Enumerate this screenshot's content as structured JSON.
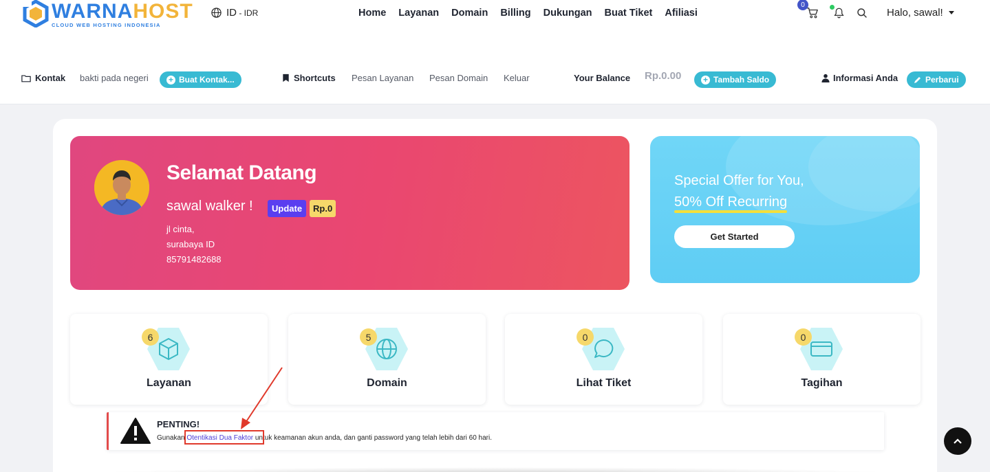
{
  "brand": {
    "word_part1": "WARNA",
    "word_part2": "HOST",
    "tagline": "CLOUD WEB HOSTING INDONESIA"
  },
  "lang": {
    "code": "ID",
    "sep": " - ",
    "currency": "IDR"
  },
  "nav": [
    {
      "label": "Home"
    },
    {
      "label": "Layanan"
    },
    {
      "label": "Domain"
    },
    {
      "label": "Billing"
    },
    {
      "label": "Dukungan"
    },
    {
      "label": "Buat Tiket"
    },
    {
      "label": "Afiliasi"
    }
  ],
  "header": {
    "cart_count": "0",
    "greeting": "Halo, sawal!"
  },
  "subbar": {
    "contact_label": "Kontak",
    "contact_value": "bakti pada negeri",
    "contact_button": "Buat Kontak...",
    "shortcuts_label": "Shortcuts",
    "shortcuts": [
      "Pesan Layanan",
      "Pesan Domain",
      "Keluar"
    ],
    "balance_label": "Your Balance",
    "balance_value": "Rp.0.00",
    "balance_button": "Tambah Saldo",
    "info_label": "Informasi Anda",
    "info_button": "Perbarui"
  },
  "welcome": {
    "title": "Selamat Datang",
    "name": "sawal walker !",
    "badge_update": "Update",
    "badge_credit": "Rp.0",
    "address1": "jl cinta,",
    "address2": "surabaya ID",
    "phone": "85791482688"
  },
  "offer": {
    "line1": "Special Offer for You,",
    "line2": "50% Off Recurring",
    "button": "Get Started"
  },
  "stats": [
    {
      "label": "Layanan",
      "count": "6",
      "icon": "box-icon"
    },
    {
      "label": "Domain",
      "count": "5",
      "icon": "globe-icon"
    },
    {
      "label": "Lihat Tiket",
      "count": "0",
      "icon": "chat-icon"
    },
    {
      "label": "Tagihan",
      "count": "0",
      "icon": "credit-card-icon"
    }
  ],
  "alert": {
    "title": "PENTING!",
    "text_before": "Gunakan ",
    "link": "Otentikasi Dua Faktor",
    "text_after": " untuk keamanan akun anda, dan ganti password yang telah lebih dari 60 hari."
  },
  "colors": {
    "accent": "#38bad3",
    "welcome_from": "#e0477f",
    "welcome_to": "#ec5560",
    "offer": "#5fcdf4",
    "badge": "#f6d86a",
    "alert_border": "#e24b4b"
  }
}
